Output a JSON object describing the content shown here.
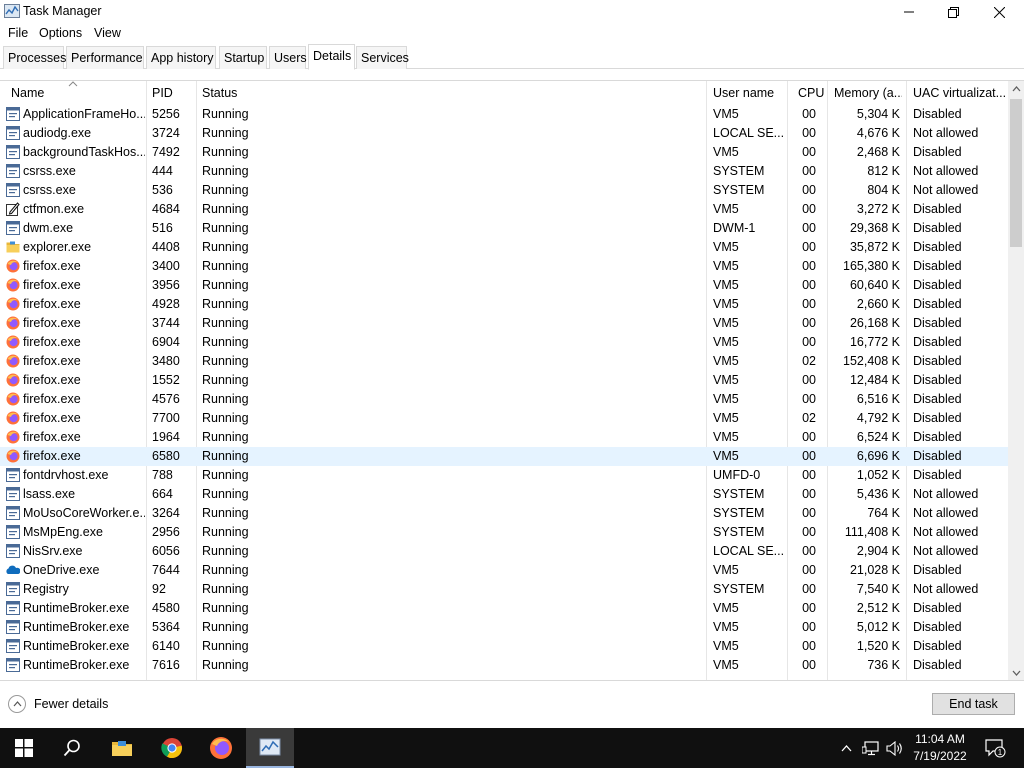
{
  "window": {
    "title": "Task Manager"
  },
  "menu": [
    "File",
    "Options",
    "View"
  ],
  "tabs": [
    {
      "label": "Processes",
      "active": false
    },
    {
      "label": "Performance",
      "active": false
    },
    {
      "label": "App history",
      "active": false
    },
    {
      "label": "Startup",
      "active": false
    },
    {
      "label": "Users",
      "active": false
    },
    {
      "label": "Details",
      "active": true
    },
    {
      "label": "Services",
      "active": false
    }
  ],
  "columns": {
    "name": "Name",
    "pid": "PID",
    "status": "Status",
    "user": "User name",
    "cpu": "CPU",
    "memory": "Memory (a...",
    "uac": "UAC virtualizat..."
  },
  "rows": [
    {
      "icon": "app-window-icon",
      "name": "ApplicationFrameHo...",
      "pid": "5256",
      "status": "Running",
      "user": "VM5",
      "cpu": "00",
      "memory": "5,304 K",
      "uac": "Disabled"
    },
    {
      "icon": "app-window-icon",
      "name": "audiodg.exe",
      "pid": "3724",
      "status": "Running",
      "user": "LOCAL SE...",
      "cpu": "00",
      "memory": "4,676 K",
      "uac": "Not allowed"
    },
    {
      "icon": "app-window-icon",
      "name": "backgroundTaskHos...",
      "pid": "7492",
      "status": "Running",
      "user": "VM5",
      "cpu": "00",
      "memory": "2,468 K",
      "uac": "Disabled"
    },
    {
      "icon": "app-window-icon",
      "name": "csrss.exe",
      "pid": "444",
      "status": "Running",
      "user": "SYSTEM",
      "cpu": "00",
      "memory": "812 K",
      "uac": "Not allowed"
    },
    {
      "icon": "app-window-icon",
      "name": "csrss.exe",
      "pid": "536",
      "status": "Running",
      "user": "SYSTEM",
      "cpu": "00",
      "memory": "804 K",
      "uac": "Not allowed"
    },
    {
      "icon": "pen-icon",
      "name": "ctfmon.exe",
      "pid": "4684",
      "status": "Running",
      "user": "VM5",
      "cpu": "00",
      "memory": "3,272 K",
      "uac": "Disabled"
    },
    {
      "icon": "app-window-icon",
      "name": "dwm.exe",
      "pid": "516",
      "status": "Running",
      "user": "DWM-1",
      "cpu": "00",
      "memory": "29,368 K",
      "uac": "Disabled"
    },
    {
      "icon": "folder-icon",
      "name": "explorer.exe",
      "pid": "4408",
      "status": "Running",
      "user": "VM5",
      "cpu": "00",
      "memory": "35,872 K",
      "uac": "Disabled"
    },
    {
      "icon": "firefox-icon",
      "name": "firefox.exe",
      "pid": "3400",
      "status": "Running",
      "user": "VM5",
      "cpu": "00",
      "memory": "165,380 K",
      "uac": "Disabled"
    },
    {
      "icon": "firefox-icon",
      "name": "firefox.exe",
      "pid": "3956",
      "status": "Running",
      "user": "VM5",
      "cpu": "00",
      "memory": "60,640 K",
      "uac": "Disabled"
    },
    {
      "icon": "firefox-icon",
      "name": "firefox.exe",
      "pid": "4928",
      "status": "Running",
      "user": "VM5",
      "cpu": "00",
      "memory": "2,660 K",
      "uac": "Disabled"
    },
    {
      "icon": "firefox-icon",
      "name": "firefox.exe",
      "pid": "3744",
      "status": "Running",
      "user": "VM5",
      "cpu": "00",
      "memory": "26,168 K",
      "uac": "Disabled"
    },
    {
      "icon": "firefox-icon",
      "name": "firefox.exe",
      "pid": "6904",
      "status": "Running",
      "user": "VM5",
      "cpu": "00",
      "memory": "16,772 K",
      "uac": "Disabled"
    },
    {
      "icon": "firefox-icon",
      "name": "firefox.exe",
      "pid": "3480",
      "status": "Running",
      "user": "VM5",
      "cpu": "02",
      "memory": "152,408 K",
      "uac": "Disabled"
    },
    {
      "icon": "firefox-icon",
      "name": "firefox.exe",
      "pid": "1552",
      "status": "Running",
      "user": "VM5",
      "cpu": "00",
      "memory": "12,484 K",
      "uac": "Disabled"
    },
    {
      "icon": "firefox-icon",
      "name": "firefox.exe",
      "pid": "4576",
      "status": "Running",
      "user": "VM5",
      "cpu": "00",
      "memory": "6,516 K",
      "uac": "Disabled"
    },
    {
      "icon": "firefox-icon",
      "name": "firefox.exe",
      "pid": "7700",
      "status": "Running",
      "user": "VM5",
      "cpu": "02",
      "memory": "4,792 K",
      "uac": "Disabled"
    },
    {
      "icon": "firefox-icon",
      "name": "firefox.exe",
      "pid": "1964",
      "status": "Running",
      "user": "VM5",
      "cpu": "00",
      "memory": "6,524 K",
      "uac": "Disabled"
    },
    {
      "icon": "firefox-icon",
      "name": "firefox.exe",
      "pid": "6580",
      "status": "Running",
      "user": "VM5",
      "cpu": "00",
      "memory": "6,696 K",
      "uac": "Disabled",
      "selected": true
    },
    {
      "icon": "app-window-icon",
      "name": "fontdrvhost.exe",
      "pid": "788",
      "status": "Running",
      "user": "UMFD-0",
      "cpu": "00",
      "memory": "1,052 K",
      "uac": "Disabled"
    },
    {
      "icon": "app-window-icon",
      "name": "lsass.exe",
      "pid": "664",
      "status": "Running",
      "user": "SYSTEM",
      "cpu": "00",
      "memory": "5,436 K",
      "uac": "Not allowed"
    },
    {
      "icon": "app-window-icon",
      "name": "MoUsoCoreWorker.e...",
      "pid": "3264",
      "status": "Running",
      "user": "SYSTEM",
      "cpu": "00",
      "memory": "764 K",
      "uac": "Not allowed"
    },
    {
      "icon": "app-window-icon",
      "name": "MsMpEng.exe",
      "pid": "2956",
      "status": "Running",
      "user": "SYSTEM",
      "cpu": "00",
      "memory": "111,408 K",
      "uac": "Not allowed"
    },
    {
      "icon": "app-window-icon",
      "name": "NisSrv.exe",
      "pid": "6056",
      "status": "Running",
      "user": "LOCAL SE...",
      "cpu": "00",
      "memory": "2,904 K",
      "uac": "Not allowed"
    },
    {
      "icon": "onedrive-icon",
      "name": "OneDrive.exe",
      "pid": "7644",
      "status": "Running",
      "user": "VM5",
      "cpu": "00",
      "memory": "21,028 K",
      "uac": "Disabled"
    },
    {
      "icon": "app-window-icon",
      "name": "Registry",
      "pid": "92",
      "status": "Running",
      "user": "SYSTEM",
      "cpu": "00",
      "memory": "7,540 K",
      "uac": "Not allowed"
    },
    {
      "icon": "app-window-icon",
      "name": "RuntimeBroker.exe",
      "pid": "4580",
      "status": "Running",
      "user": "VM5",
      "cpu": "00",
      "memory": "2,512 K",
      "uac": "Disabled"
    },
    {
      "icon": "app-window-icon",
      "name": "RuntimeBroker.exe",
      "pid": "5364",
      "status": "Running",
      "user": "VM5",
      "cpu": "00",
      "memory": "5,012 K",
      "uac": "Disabled"
    },
    {
      "icon": "app-window-icon",
      "name": "RuntimeBroker.exe",
      "pid": "6140",
      "status": "Running",
      "user": "VM5",
      "cpu": "00",
      "memory": "1,520 K",
      "uac": "Disabled"
    },
    {
      "icon": "app-window-icon",
      "name": "RuntimeBroker.exe",
      "pid": "7616",
      "status": "Running",
      "user": "VM5",
      "cpu": "00",
      "memory": "736 K",
      "uac": "Disabled"
    }
  ],
  "footer": {
    "fewer_details": "Fewer details",
    "end_task": "End task"
  },
  "taskbar": {
    "apps": [
      "windows-start-icon",
      "search-icon",
      "file-explorer-icon",
      "chrome-icon",
      "firefox-icon",
      "task-manager-icon"
    ],
    "time": "11:04 AM",
    "date": "7/19/2022",
    "notification_count": "1"
  },
  "colors": {
    "selected_row": "#e5f3ff",
    "taskbar": "#101010",
    "firefox": "#ff7139"
  }
}
